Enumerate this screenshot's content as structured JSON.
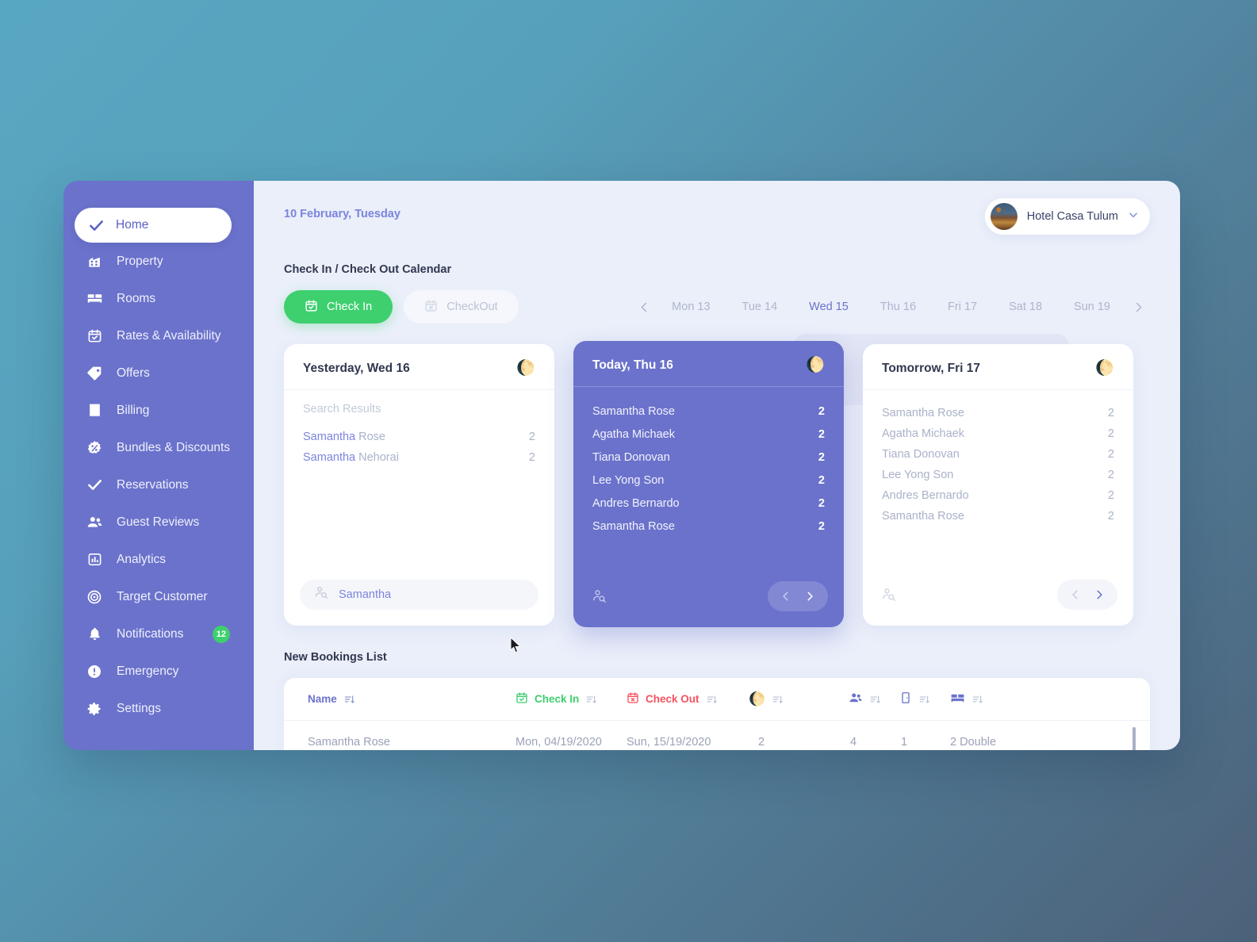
{
  "sidebar": {
    "items": [
      {
        "label": "Home",
        "icon": "check-icon",
        "active": true
      },
      {
        "label": "Property",
        "icon": "building-icon",
        "active": false
      },
      {
        "label": "Rooms",
        "icon": "bed-icon",
        "active": false
      },
      {
        "label": "Rates & Availability",
        "icon": "calendar-check-icon",
        "active": false
      },
      {
        "label": "Offers",
        "icon": "tag-icon",
        "active": false
      },
      {
        "label": "Billing",
        "icon": "receipt-icon",
        "active": false
      },
      {
        "label": "Bundles & Discounts",
        "icon": "discount-badge-icon",
        "active": false
      },
      {
        "label": "Reservations",
        "icon": "check-icon",
        "active": false
      },
      {
        "label": "Guest Reviews",
        "icon": "people-icon",
        "active": false
      },
      {
        "label": "Analytics",
        "icon": "bar-chart-icon",
        "active": false
      },
      {
        "label": "Target Customer",
        "icon": "target-icon",
        "active": false
      },
      {
        "label": "Notifications",
        "icon": "bell-icon",
        "active": false,
        "badge": "12"
      },
      {
        "label": "Emergency",
        "icon": "alert-circle-icon",
        "active": false
      },
      {
        "label": "Settings",
        "icon": "gear-icon",
        "active": false
      }
    ]
  },
  "header": {
    "date": "10 February, Tuesday",
    "hotel_name": "Hotel Casa Tulum",
    "chevron": "chevron-down-icon"
  },
  "calendar": {
    "section_title": "Check In / Check Out Calendar",
    "checkin_label": "Check In",
    "checkout_label": "CheckOut",
    "days": [
      {
        "label": "Mon 13",
        "selected": false
      },
      {
        "label": "Tue 14",
        "selected": false
      },
      {
        "label": "Wed 15",
        "selected": true
      },
      {
        "label": "Thu 16",
        "selected": false
      },
      {
        "label": "Fri 17",
        "selected": false
      },
      {
        "label": "Sat 18",
        "selected": false
      },
      {
        "label": "Sun 19",
        "selected": false
      }
    ],
    "cards": [
      {
        "title": "Yesterday, Wed 16",
        "results_label": "Search Results",
        "guests": [
          {
            "highlight": "Samantha",
            "rest": " Rose",
            "count": "2"
          },
          {
            "highlight": "Samantha",
            "rest": " Nehorai",
            "count": "2"
          }
        ],
        "search_value": "Samantha"
      },
      {
        "title": "Today, Thu 16",
        "guests": [
          {
            "name": "Samantha Rose",
            "count": "2"
          },
          {
            "name": "Agatha Michaek",
            "count": "2"
          },
          {
            "name": "Tiana Donovan",
            "count": "2"
          },
          {
            "name": "Lee Yong Son",
            "count": "2"
          },
          {
            "name": "Andres Bernardo",
            "count": "2"
          },
          {
            "name": "Samantha Rose",
            "count": "2"
          }
        ]
      },
      {
        "title": "Tomorrow, Fri 17",
        "guests": [
          {
            "name": "Samantha Rose",
            "count": "2"
          },
          {
            "name": "Agatha Michaek",
            "count": "2"
          },
          {
            "name": "Tiana Donovan",
            "count": "2"
          },
          {
            "name": "Lee Yong Son",
            "count": "2"
          },
          {
            "name": "Andres Bernardo",
            "count": "2"
          },
          {
            "name": "Samantha Rose",
            "count": "2"
          }
        ]
      }
    ]
  },
  "bookings": {
    "title": "New Bookings List",
    "columns": [
      {
        "label": "Name",
        "icon": "none"
      },
      {
        "label": "Check In",
        "icon": "calendar-check-green-icon"
      },
      {
        "label": "Check Out",
        "icon": "calendar-x-red-icon"
      },
      {
        "label": "",
        "icon": "moon-icon"
      },
      {
        "label": "",
        "icon": "people-icon"
      },
      {
        "label": "",
        "icon": "door-icon"
      },
      {
        "label": "",
        "icon": "bed-icon"
      }
    ],
    "rows": [
      {
        "name": "Samantha Rose",
        "check_in": "Mon, 04/19/2020",
        "check_out": "Sun, 15/19/2020",
        "nights": "2",
        "guests": "4",
        "rooms": "1",
        "beds": "2 Double"
      }
    ]
  },
  "colors": {
    "sidebar": "#6b72cb",
    "accent_green": "#3ecf6e",
    "accent_red": "#f6525f",
    "accent_purple": "#6b72cb",
    "badge_green": "#3ecf6e",
    "moon_yellow": "#f7ce4b",
    "main_bg": "#eaeffa"
  }
}
